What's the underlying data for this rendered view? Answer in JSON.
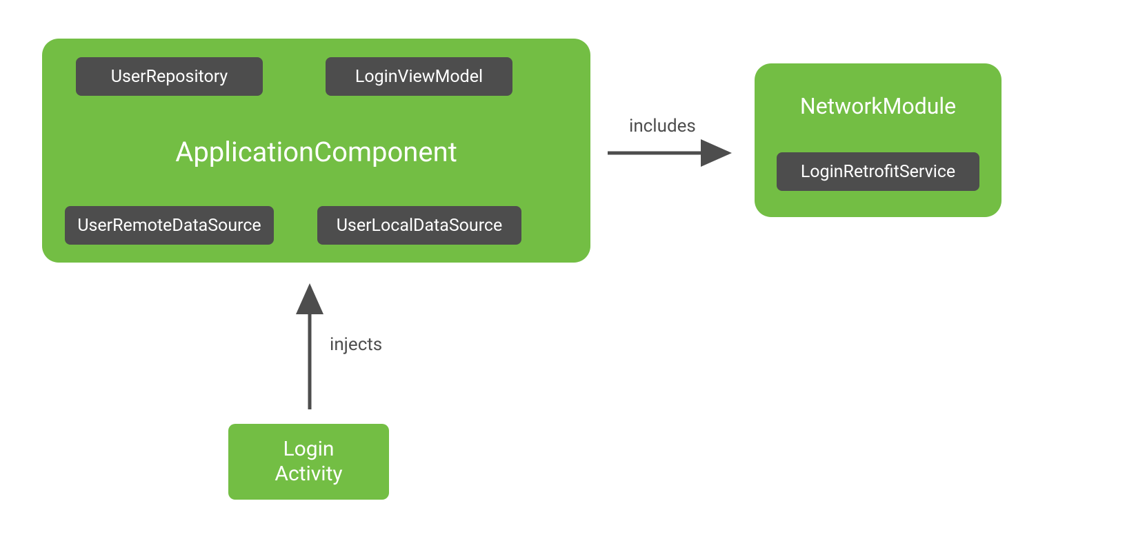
{
  "applicationComponent": {
    "title": "ApplicationComponent",
    "chips": {
      "userRepository": "UserRepository",
      "loginViewModel": "LoginViewModel",
      "userRemoteDataSource": "UserRemoteDataSource",
      "userLocalDataSource": "UserLocalDataSource"
    }
  },
  "networkModule": {
    "title": "NetworkModule",
    "chip": "LoginRetrofitService"
  },
  "arrows": {
    "includes": "includes",
    "injects": "injects"
  },
  "loginActivity": {
    "line1": "Login",
    "line2": "Activity"
  },
  "colors": {
    "green": "#73be44",
    "dark": "#4d4d4d",
    "arrow": "#4d4d4d"
  }
}
